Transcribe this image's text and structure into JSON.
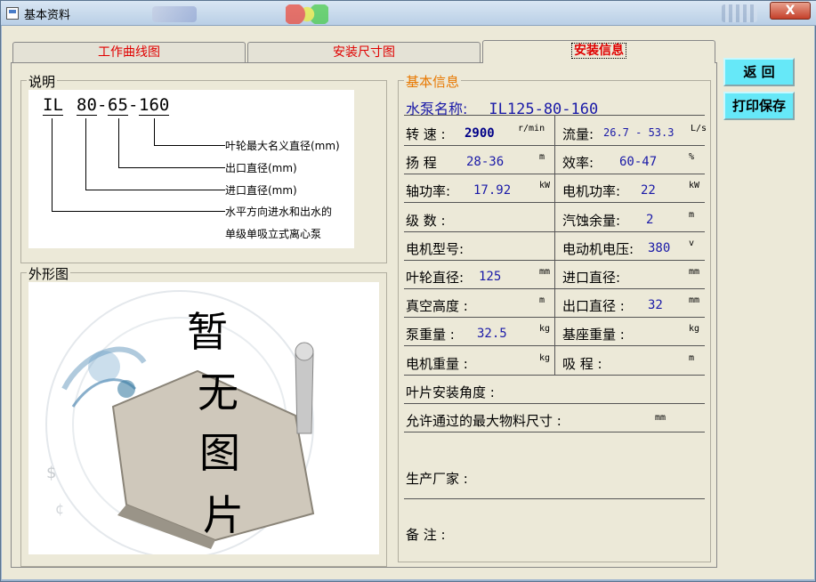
{
  "window": {
    "title": "基本资料",
    "close_glyph": "X"
  },
  "tabs": [
    {
      "label": "工作曲线图"
    },
    {
      "label": "安装尺寸图"
    },
    {
      "label": "安装信息"
    }
  ],
  "description": {
    "title": "说明",
    "model_parts": [
      "IL",
      "80",
      "-",
      "65",
      "-",
      "160"
    ],
    "legend": [
      "叶轮最大名义直径(mm)",
      "出口直径(mm)",
      "进口直径(mm)",
      "水平方向进水和出水的",
      "单级单吸立式离心泵"
    ]
  },
  "shape": {
    "title": "外形图",
    "placeholder_chars": [
      "暂",
      "无",
      "图",
      "片"
    ]
  },
  "basic_info": {
    "title": "基本信息",
    "pump_name_label": "水泵名称:",
    "pump_name_value": "IL125-80-160",
    "rows": [
      {
        "l_label": "转  速 :",
        "l_value": "2900",
        "l_unit": "r/min",
        "r_label": "流量:",
        "r_value": "26.7 - 53.3",
        "r_unit": "L/s"
      },
      {
        "l_label": "扬  程",
        "l_value": "28-36",
        "l_unit": "m",
        "r_label": "效率:",
        "r_value": "60-47",
        "r_unit": "%"
      },
      {
        "l_label": "轴功率:",
        "l_value": "17.92",
        "l_unit": "kW",
        "r_label": "电机功率:",
        "r_value": "22",
        "r_unit": "kW"
      },
      {
        "l_label": "级  数 :",
        "l_value": "",
        "l_unit": "",
        "r_label": "汽蚀余量:",
        "r_value": "2",
        "r_unit": "m"
      },
      {
        "l_label": "电机型号:",
        "l_value": "",
        "l_unit": "",
        "r_label": "电动机电压:",
        "r_value": "380",
        "r_unit": "v"
      },
      {
        "l_label": "叶轮直径:",
        "l_value": "125",
        "l_unit": "mm",
        "r_label": "进口直径:",
        "r_value": "",
        "r_unit": "mm"
      },
      {
        "l_label": "真空高度 :",
        "l_value": "",
        "l_unit": "m",
        "r_label": "出口直径 :",
        "r_value": "32",
        "r_unit": "mm"
      },
      {
        "l_label": "泵重量 :",
        "l_value": "32.5",
        "l_unit": "kg",
        "r_label": "基座重量 :",
        "r_value": "",
        "r_unit": "kg"
      },
      {
        "l_label": "电机重量 :",
        "l_value": "",
        "l_unit": "kg",
        "r_label": "吸  程 :",
        "r_value": "",
        "r_unit": "m"
      }
    ],
    "blade_angle_label": "叶片安装角度 :",
    "max_material_label": "允许通过的最大物料尺寸 :",
    "max_material_unit": "mm",
    "manufacturer_label": "生产厂家 :",
    "remark_label": "备  注 :"
  },
  "buttons": {
    "back": "返  回",
    "print_save": "打印保存"
  }
}
